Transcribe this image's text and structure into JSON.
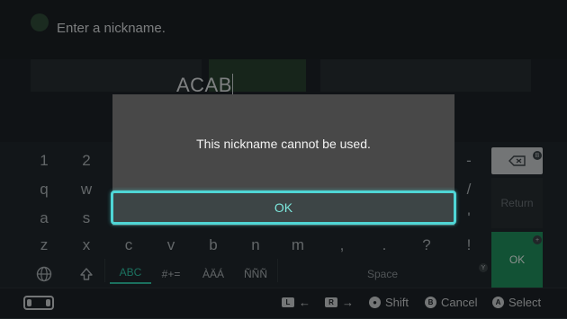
{
  "header": {
    "title": "Enter a nickname."
  },
  "entry": {
    "value": "ACAB"
  },
  "keyboard": {
    "row1": [
      "1",
      "2",
      "-"
    ],
    "row2": [
      "q",
      "w",
      "/"
    ],
    "row3": [
      "a",
      "s",
      "'"
    ],
    "row4": [
      "z",
      "x",
      "c",
      "v",
      "b",
      "n",
      "m",
      ",",
      ".",
      "?",
      "!"
    ],
    "modes": {
      "abc": "ABC",
      "symbols": "#+=",
      "accents_upper": "ÀÄÁ",
      "accents_n": "ÑÑÑ"
    },
    "space_label": "Space",
    "return_label": "Return",
    "ok_label": "OK"
  },
  "dialog": {
    "message": "This nickname cannot be used.",
    "ok_label": "OK"
  },
  "footer": {
    "l_hint": "←",
    "r_hint": "→",
    "shift_label": "Shift",
    "cancel_label": "Cancel",
    "select_label": "Select",
    "l_glyph": "L",
    "r_glyph": "R",
    "b_glyph": "B",
    "a_glyph": "A"
  },
  "colors": {
    "accent_teal": "#4fd6d6",
    "ok_green": "#1f8e5c",
    "dialog_bg": "#484848"
  }
}
